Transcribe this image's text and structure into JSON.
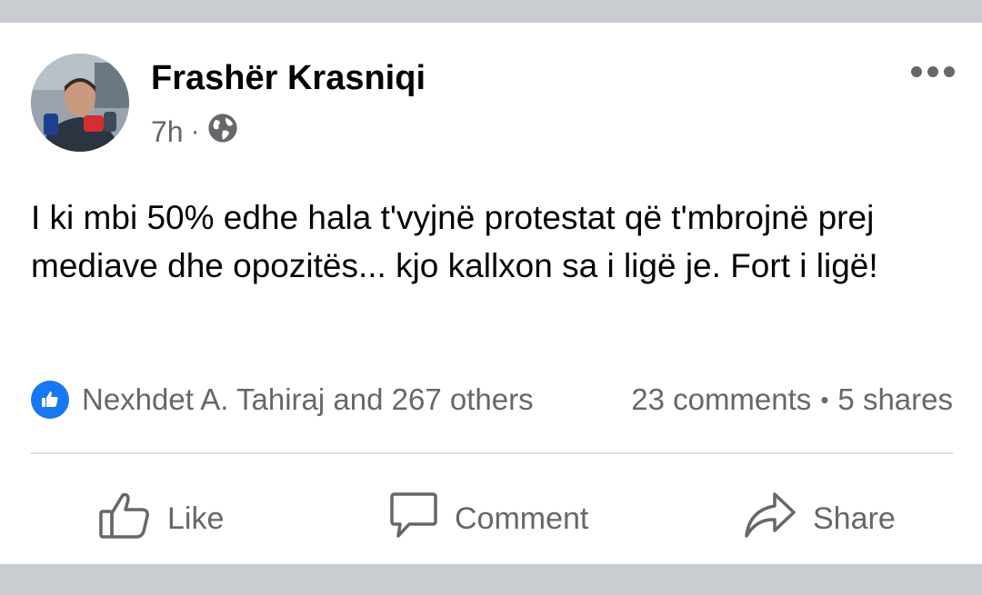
{
  "post": {
    "author": "Frashër Krasniqi",
    "time": "7h",
    "separator": "·",
    "text": "I ki mbi 50% edhe hala t'vyjnë protestat që t'mbrojnë prej mediave dhe opozitës... kjo kallxon sa i ligë je. Fort i ligë!"
  },
  "stats": {
    "reactors": "Nexhdet A. Tahiraj and 267 others",
    "comments": "23 comments",
    "bullet": "•",
    "shares": "5 shares"
  },
  "actions": {
    "like": "Like",
    "comment": "Comment",
    "share": "Share"
  },
  "colors": {
    "accent": "#1877f2",
    "text": "#050505",
    "secondary": "#65676b",
    "divider": "#dadde1",
    "band": "#c9ccd1"
  },
  "icons": [
    "globe-icon",
    "more-options-icon",
    "like-reaction-icon",
    "like-icon",
    "comment-icon",
    "share-icon"
  ]
}
